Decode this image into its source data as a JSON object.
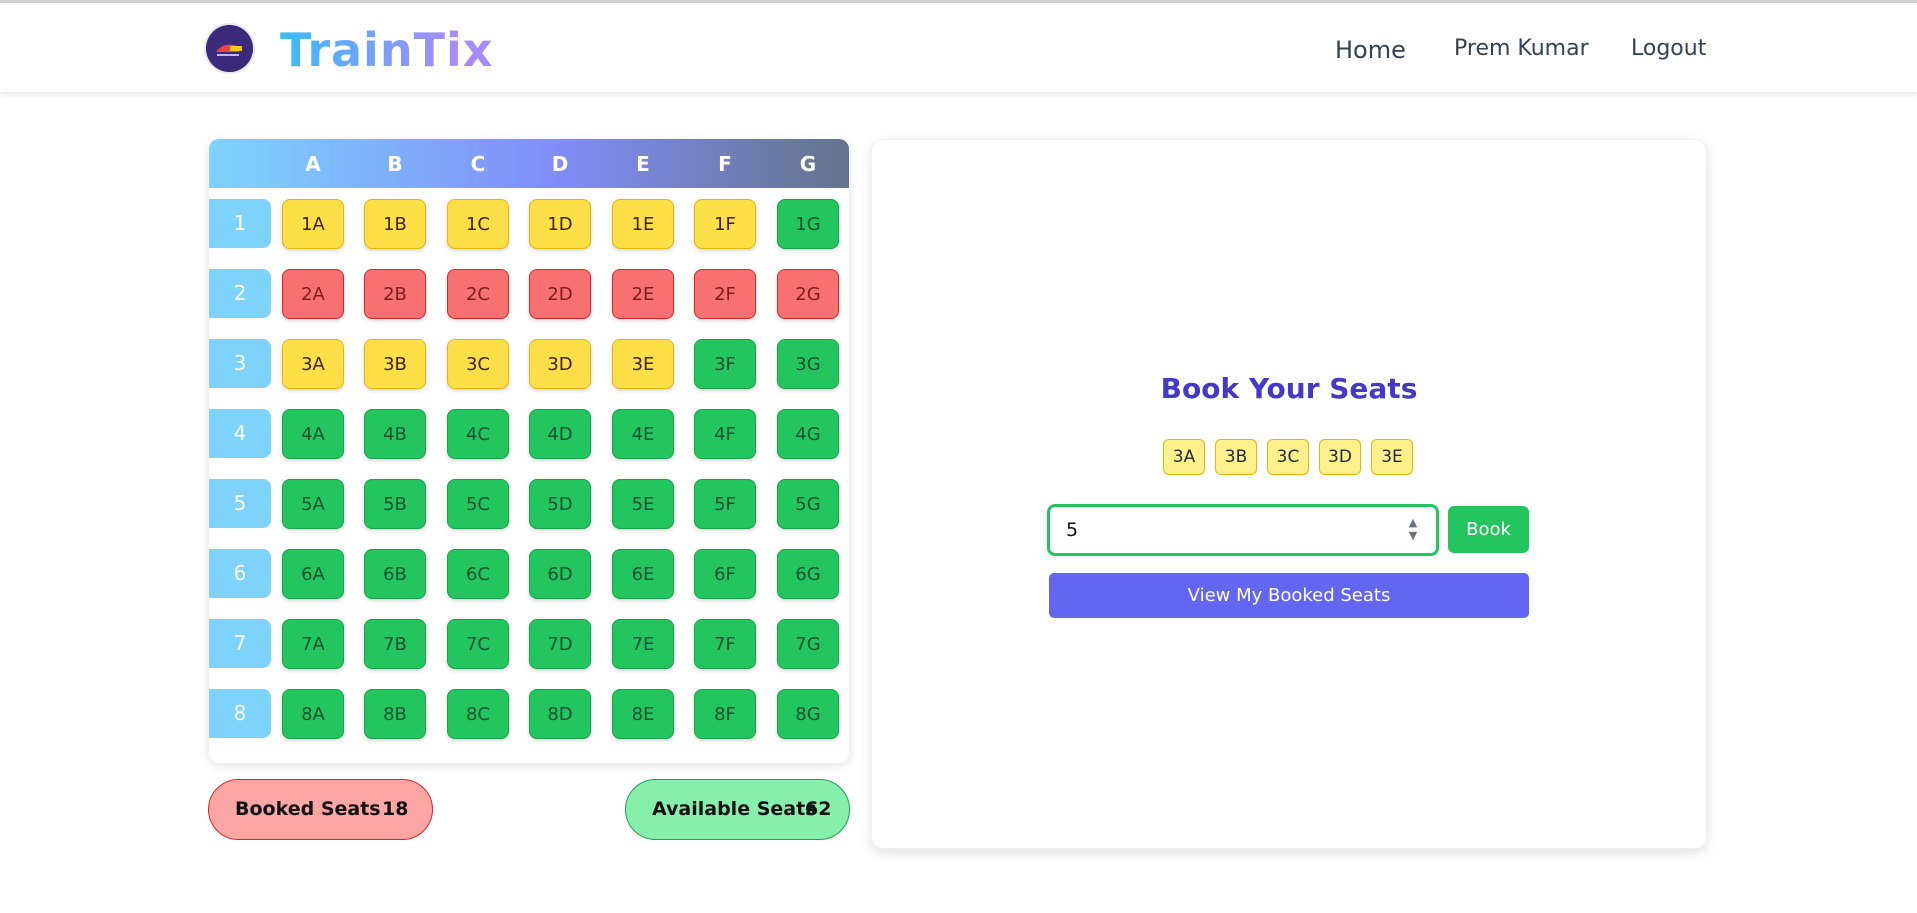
{
  "header": {
    "brand": "TrainTix",
    "logo_icon": "train-logo-icon",
    "nav": {
      "home": "Home",
      "user": "Prem Kumar",
      "logout": "Logout"
    }
  },
  "grid": {
    "columns": [
      "A",
      "B",
      "C",
      "D",
      "E",
      "F",
      "G"
    ],
    "rows": [
      {
        "label": "1",
        "seats": [
          {
            "id": "1A",
            "status": "selected"
          },
          {
            "id": "1B",
            "status": "selected"
          },
          {
            "id": "1C",
            "status": "selected"
          },
          {
            "id": "1D",
            "status": "selected"
          },
          {
            "id": "1E",
            "status": "selected"
          },
          {
            "id": "1F",
            "status": "selected"
          },
          {
            "id": "1G",
            "status": "available"
          }
        ]
      },
      {
        "label": "2",
        "seats": [
          {
            "id": "2A",
            "status": "booked"
          },
          {
            "id": "2B",
            "status": "booked"
          },
          {
            "id": "2C",
            "status": "booked"
          },
          {
            "id": "2D",
            "status": "booked"
          },
          {
            "id": "2E",
            "status": "booked"
          },
          {
            "id": "2F",
            "status": "booked"
          },
          {
            "id": "2G",
            "status": "booked"
          }
        ]
      },
      {
        "label": "3",
        "seats": [
          {
            "id": "3A",
            "status": "selected"
          },
          {
            "id": "3B",
            "status": "selected"
          },
          {
            "id": "3C",
            "status": "selected"
          },
          {
            "id": "3D",
            "status": "selected"
          },
          {
            "id": "3E",
            "status": "selected"
          },
          {
            "id": "3F",
            "status": "available"
          },
          {
            "id": "3G",
            "status": "available"
          }
        ]
      },
      {
        "label": "4",
        "seats": [
          {
            "id": "4A",
            "status": "available"
          },
          {
            "id": "4B",
            "status": "available"
          },
          {
            "id": "4C",
            "status": "available"
          },
          {
            "id": "4D",
            "status": "available"
          },
          {
            "id": "4E",
            "status": "available"
          },
          {
            "id": "4F",
            "status": "available"
          },
          {
            "id": "4G",
            "status": "available"
          }
        ]
      },
      {
        "label": "5",
        "seats": [
          {
            "id": "5A",
            "status": "available"
          },
          {
            "id": "5B",
            "status": "available"
          },
          {
            "id": "5C",
            "status": "available"
          },
          {
            "id": "5D",
            "status": "available"
          },
          {
            "id": "5E",
            "status": "available"
          },
          {
            "id": "5F",
            "status": "available"
          },
          {
            "id": "5G",
            "status": "available"
          }
        ]
      },
      {
        "label": "6",
        "seats": [
          {
            "id": "6A",
            "status": "available"
          },
          {
            "id": "6B",
            "status": "available"
          },
          {
            "id": "6C",
            "status": "available"
          },
          {
            "id": "6D",
            "status": "available"
          },
          {
            "id": "6E",
            "status": "available"
          },
          {
            "id": "6F",
            "status": "available"
          },
          {
            "id": "6G",
            "status": "available"
          }
        ]
      },
      {
        "label": "7",
        "seats": [
          {
            "id": "7A",
            "status": "available"
          },
          {
            "id": "7B",
            "status": "available"
          },
          {
            "id": "7C",
            "status": "available"
          },
          {
            "id": "7D",
            "status": "available"
          },
          {
            "id": "7E",
            "status": "available"
          },
          {
            "id": "7F",
            "status": "available"
          },
          {
            "id": "7G",
            "status": "available"
          }
        ]
      },
      {
        "label": "8",
        "seats": [
          {
            "id": "8A",
            "status": "available"
          },
          {
            "id": "8B",
            "status": "available"
          },
          {
            "id": "8C",
            "status": "available"
          },
          {
            "id": "8D",
            "status": "available"
          },
          {
            "id": "8E",
            "status": "available"
          },
          {
            "id": "8F",
            "status": "available"
          },
          {
            "id": "8G",
            "status": "available"
          }
        ]
      }
    ]
  },
  "summary": {
    "booked_label": "Booked Seats",
    "booked_count": "18",
    "available_label": "Available Seats",
    "available_count": "62"
  },
  "booking": {
    "title": "Book Your Seats",
    "selected_seats": [
      "3A",
      "3B",
      "3C",
      "3D",
      "3E"
    ],
    "count_value": "5",
    "book_label": "Book",
    "view_label": "View My Booked Seats"
  },
  "colors": {
    "available": "#22c55e",
    "booked": "#f87171",
    "selected": "#fde047",
    "accent": "#6366f1",
    "title": "#4338ca"
  }
}
